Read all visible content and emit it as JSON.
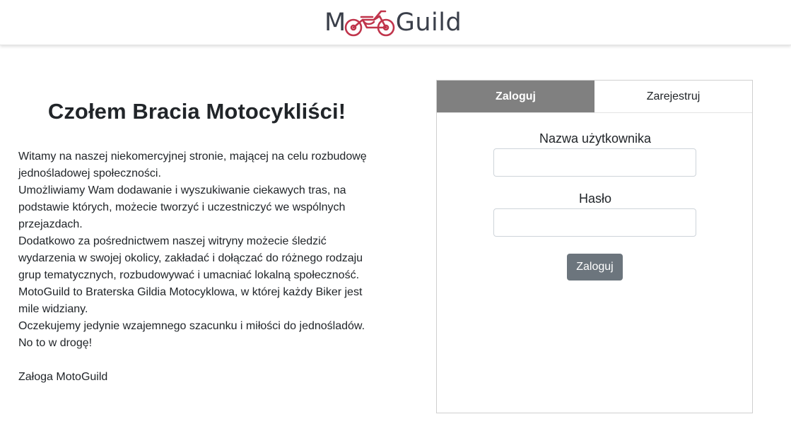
{
  "brand": {
    "name_part1": "M",
    "name_part2": "Guild",
    "logo_accent": "#c0344b",
    "logo_text_color": "#3a3f4a"
  },
  "intro": {
    "heading": "Czołem Bracia Motocykliści!",
    "paragraphs": [
      "Witamy na naszej niekomercyjnej stronie, mającej na celu rozbudowę jednośladowej społeczności.",
      "Umożliwiamy Wam dodawanie i wyszukiwanie ciekawych tras, na podstawie których, możecie tworzyć i uczestniczyć we wspólnych przejazdach.",
      "Dodatkowo za pośrednictwem naszej witryny możecie śledzić wydarzenia w swojej okolicy, zakładać i dołączać do różnego rodzaju grup tematycznych, rozbudowywać i umacniać lokalną społeczność.",
      "MotoGuild to Braterska Gildia Motocyklowa, w której każdy Biker jest mile widziany.",
      "Oczekujemy jedynie wzajemnego szacunku i miłości do jednośladów.",
      "No to w drogę!"
    ],
    "signature": "Załoga MotoGuild"
  },
  "auth": {
    "tabs": [
      {
        "label": "Zaloguj",
        "active": true
      },
      {
        "label": "Zarejestruj",
        "active": false
      }
    ],
    "username_label": "Nazwa użytkownika",
    "username_value": "",
    "password_label": "Hasło",
    "password_value": "",
    "submit_label": "Zaloguj"
  },
  "colors": {
    "active_tab_bg": "#808080",
    "button_bg": "#6c757d"
  }
}
